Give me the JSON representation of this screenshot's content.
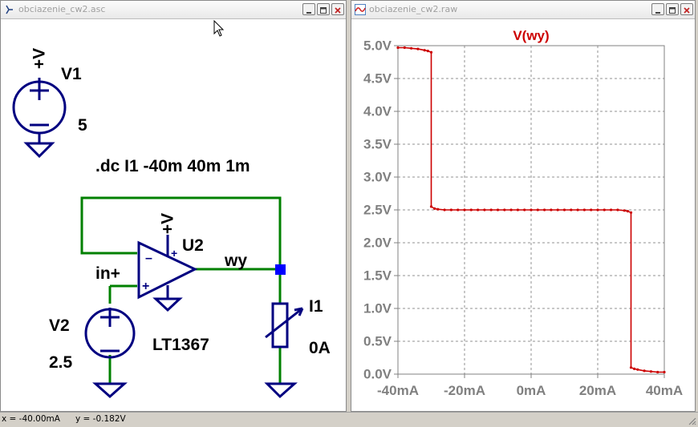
{
  "schematic_window": {
    "title": "obciazenie_cw2.asc",
    "v1": {
      "supply_label": "+V",
      "name": "V1",
      "value": "5"
    },
    "directive": ".dc I1 -40m 40m 1m",
    "u2": {
      "supply_label": "+V",
      "name": "U2",
      "model": "LT1367",
      "minus_pin": "–",
      "plus_pin": "+",
      "supply_pin": "+"
    },
    "v2": {
      "name": "V2",
      "value": "2.5"
    },
    "net_labels": {
      "output": "wy",
      "input": "in+"
    },
    "i1": {
      "name": "I1",
      "value": "0A"
    }
  },
  "plot_window": {
    "title": "obciazenie_cw2.raw",
    "trace_label": "V(wy)"
  },
  "status": {
    "x": "x = -40.00mA",
    "y": "y = -0.182V"
  },
  "colors": {
    "wire": "#008000",
    "component": "#000080",
    "trace": "#cc0000",
    "node": "#0000ff"
  },
  "icons": {
    "schematic": "ltspice-schematic-icon",
    "plot": "waveform-icon"
  },
  "chart_data": {
    "type": "line",
    "title": "V(wy)",
    "xlabel": "",
    "ylabel": "",
    "xlim": [
      -40,
      40
    ],
    "ylim": [
      0,
      5
    ],
    "grid": true,
    "x_ticks": [
      -40,
      -20,
      0,
      20,
      40
    ],
    "x_tick_labels": [
      "-40mA",
      "-20mA",
      "0mA",
      "20mA",
      "40mA"
    ],
    "y_ticks": [
      0,
      0.5,
      1,
      1.5,
      2,
      2.5,
      3,
      3.5,
      4,
      4.5,
      5
    ],
    "y_tick_labels": [
      "0.0V",
      "0.5V",
      "1.0V",
      "1.5V",
      "2.0V",
      "2.5V",
      "3.0V",
      "3.5V",
      "4.0V",
      "4.5V",
      "5.0V"
    ],
    "series": [
      {
        "name": "V(wy)",
        "x": [
          -40,
          -38,
          -36,
          -34,
          -32,
          -31,
          -30,
          -30,
          -29,
          -28,
          -26,
          -24,
          -22,
          -20,
          -18,
          -16,
          -14,
          -12,
          -10,
          -8,
          -6,
          -4,
          -2,
          0,
          2,
          4,
          6,
          8,
          10,
          12,
          14,
          16,
          18,
          20,
          22,
          24,
          26,
          28,
          29,
          30,
          30,
          31,
          32,
          34,
          36,
          38,
          40
        ],
        "y": [
          4.97,
          4.97,
          4.96,
          4.95,
          4.93,
          4.92,
          4.9,
          2.55,
          2.52,
          2.51,
          2.5,
          2.5,
          2.5,
          2.5,
          2.5,
          2.5,
          2.5,
          2.5,
          2.5,
          2.5,
          2.5,
          2.5,
          2.5,
          2.5,
          2.5,
          2.5,
          2.5,
          2.5,
          2.5,
          2.5,
          2.5,
          2.5,
          2.5,
          2.5,
          2.5,
          2.5,
          2.5,
          2.49,
          2.48,
          2.46,
          0.1,
          0.08,
          0.07,
          0.05,
          0.04,
          0.03,
          0.03
        ]
      }
    ]
  }
}
